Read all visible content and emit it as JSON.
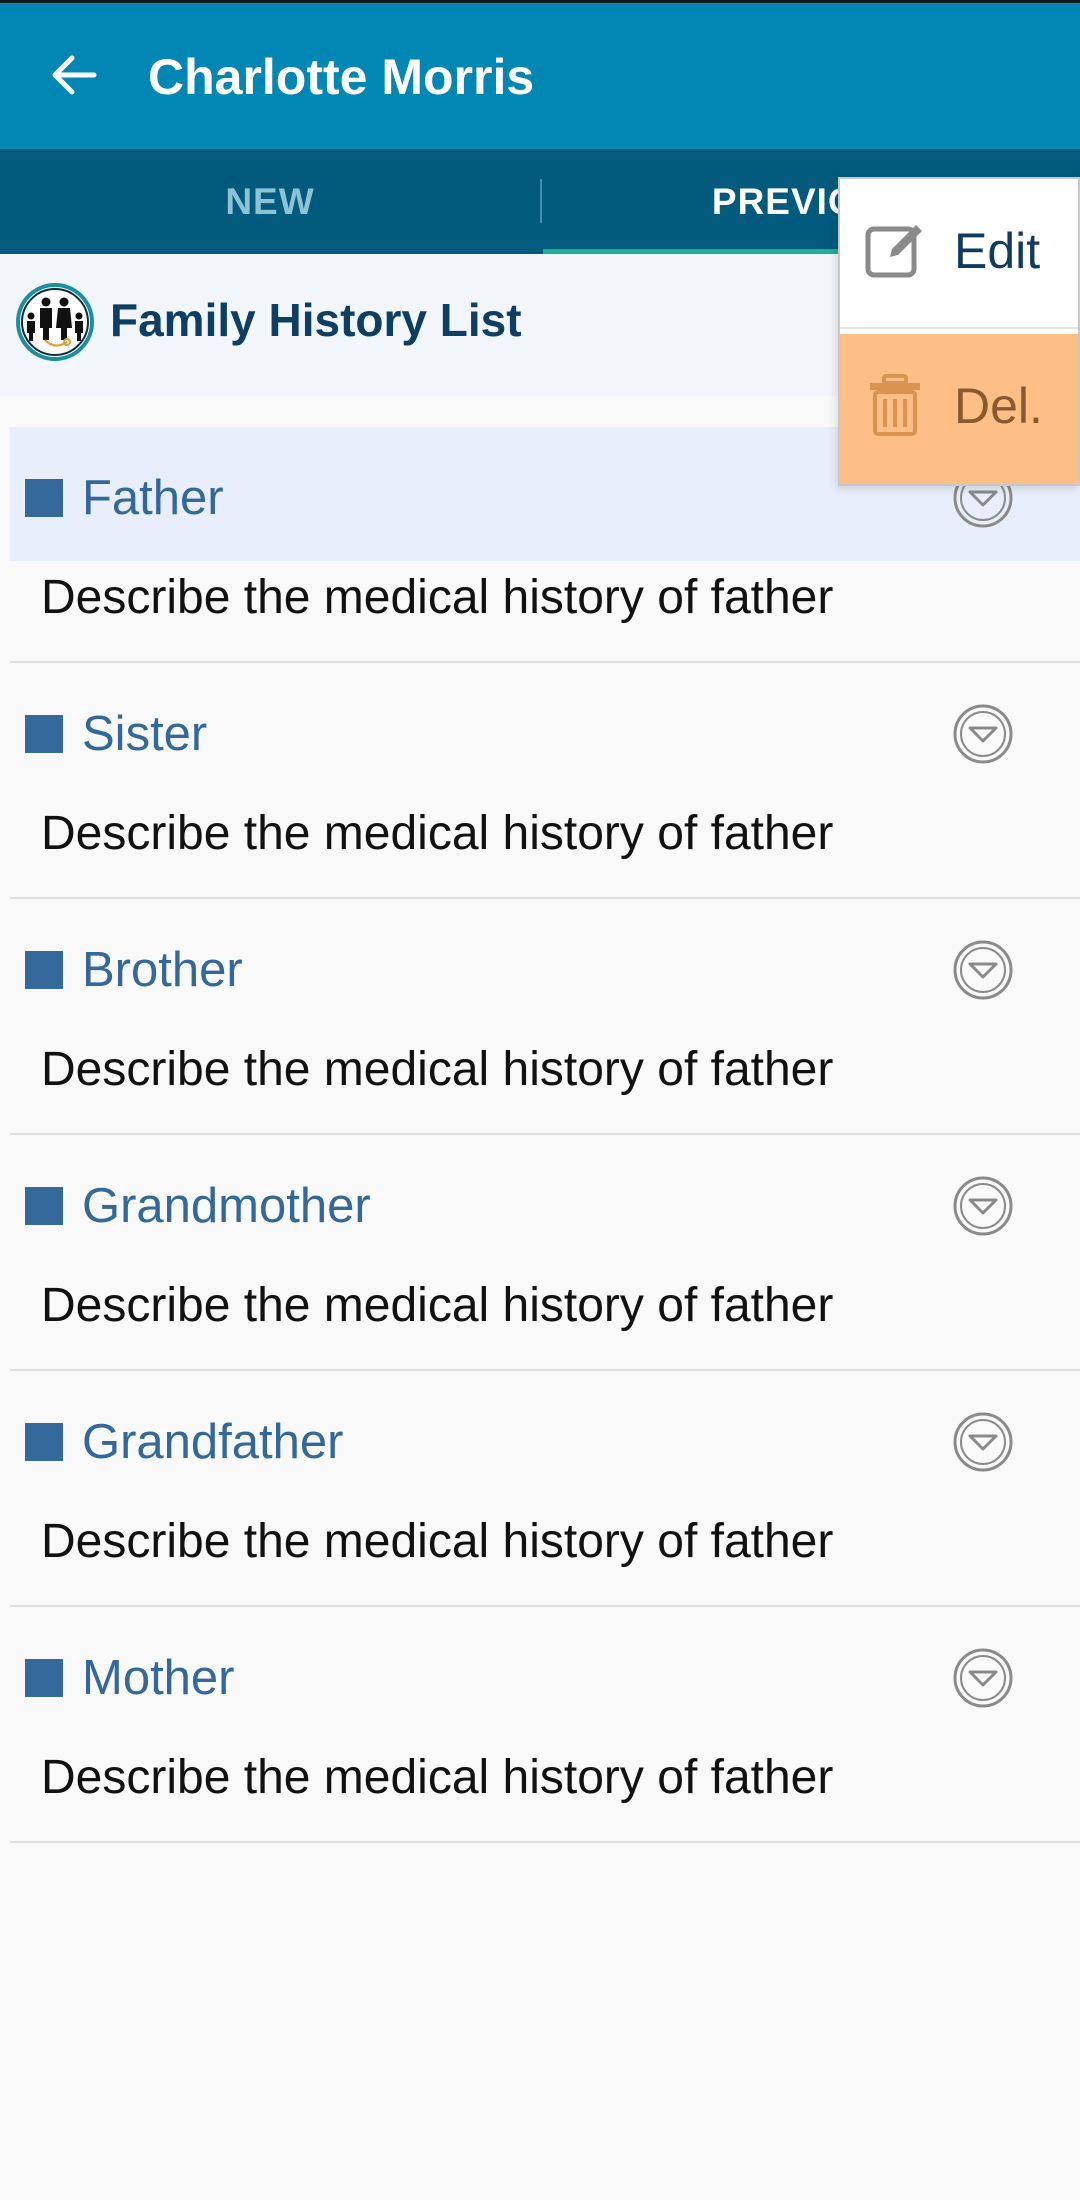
{
  "appbar": {
    "title": "Charlotte Morris",
    "back_icon": "arrow-left-icon",
    "background": "#0286b4"
  },
  "tabs": {
    "items": [
      {
        "label": "NEW",
        "selected": false
      },
      {
        "label": "PREVIOUS",
        "selected": true
      }
    ],
    "background": "#025a7d",
    "indicator_color": "#21b08f"
  },
  "section": {
    "title": "Family History List",
    "logo_icon": "family-icon"
  },
  "list": {
    "items": [
      {
        "title": "Father",
        "description": "Describe the medical history of father",
        "highlighted": true
      },
      {
        "title": "Sister",
        "description": "Describe the medical history of father",
        "highlighted": false
      },
      {
        "title": "Brother",
        "description": "Describe the medical history of father",
        "highlighted": false
      },
      {
        "title": "Grandmother",
        "description": "Describe the medical history of father",
        "highlighted": false
      },
      {
        "title": "Grandfather",
        "description": "Describe the medical history of father",
        "highlighted": false
      },
      {
        "title": "Mother",
        "description": "Describe the medical history of father",
        "highlighted": false
      }
    ],
    "bullet_color": "#35689b",
    "expand_icon": "chevron-down-circle-icon"
  },
  "context_menu": {
    "edit_label": "Edit",
    "edit_icon": "edit-icon",
    "delete_label": "Del.",
    "delete_icon": "trash-icon",
    "delete_background": "#fdbf85"
  }
}
